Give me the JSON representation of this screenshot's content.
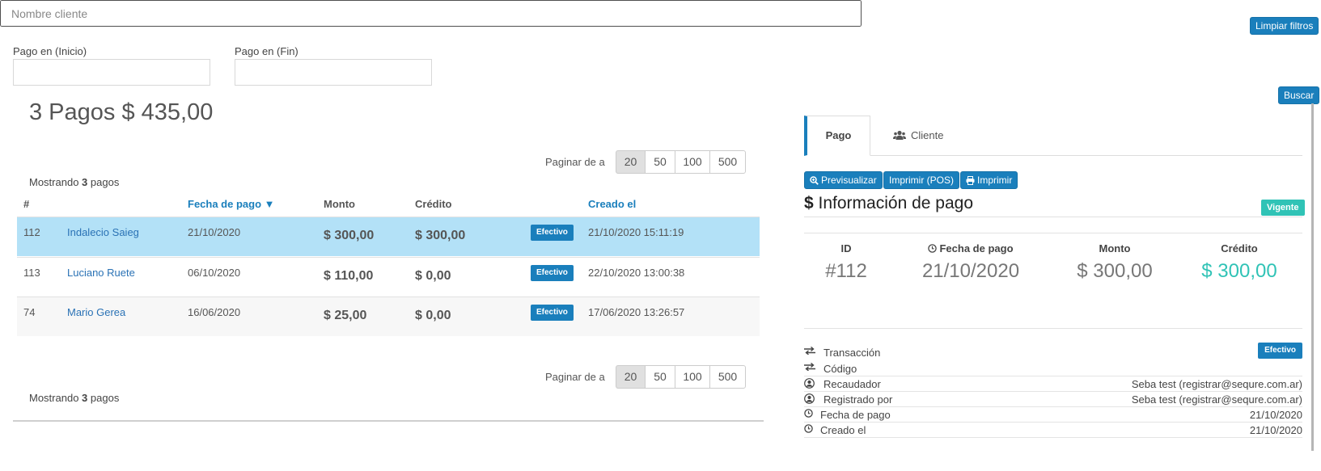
{
  "filters": {
    "search_placeholder": "Nombre cliente",
    "clear_label": "Limpiar filtros",
    "date_start_label": "Pago en (Inicio)",
    "date_end_label": "Pago en (Fin)",
    "search_button": "Buscar"
  },
  "summary": "3 Pagos $ 435,00",
  "pagination": {
    "label": "Paginar de a",
    "options": [
      "20",
      "50",
      "100",
      "500"
    ],
    "selected": "20"
  },
  "showing": {
    "prefix": "Mostrando ",
    "count": "3",
    "suffix": " pagos"
  },
  "table": {
    "headers": {
      "id": "#",
      "date": "Fecha de pago ▼",
      "amount": "Monto",
      "credit": "Crédito",
      "created": "Creado el"
    },
    "rows": [
      {
        "id": "112",
        "client": "Indalecio Saieg",
        "date": "21/10/2020",
        "amount": "$ 300,00",
        "credit": "$ 300,00",
        "method": "Efectivo",
        "created": "21/10/2020 15:11:19"
      },
      {
        "id": "113",
        "client": "Luciano Ruete",
        "date": "06/10/2020",
        "amount": "$ 110,00",
        "credit": "$ 0,00",
        "method": "Efectivo",
        "created": "22/10/2020 13:00:38"
      },
      {
        "id": "74",
        "client": "Mario Gerea",
        "date": "16/06/2020",
        "amount": "$ 25,00",
        "credit": "$ 0,00",
        "method": "Efectivo",
        "created": "17/06/2020 13:26:57"
      }
    ]
  },
  "detail": {
    "tabs": {
      "pago": "Pago",
      "cliente": "Cliente"
    },
    "actions": {
      "preview": "Previsualizar",
      "print_pos": "Imprimir (POS)",
      "print": "Imprimir"
    },
    "title": "Información de pago",
    "title_symbol": "$",
    "status": "Vigente",
    "stats": {
      "id_label": "ID",
      "id_value": "#112",
      "date_label": "Fecha de pago",
      "date_value": "21/10/2020",
      "amount_label": "Monto",
      "amount_value": "$ 300,00",
      "credit_label": "Crédito",
      "credit_value": "$ 300,00"
    },
    "fields": {
      "transaction_label": "Transacción",
      "transaction_value": "Efectivo",
      "code_label": "Código",
      "collector_label": "Recaudador",
      "collector_value": "Seba test (registrar@sequre.com.ar)",
      "registered_label": "Registrado por",
      "registered_value": "Seba test (registrar@sequre.com.ar)",
      "paydate_label": "Fecha de pago",
      "paydate_value": "21/10/2020",
      "created_label": "Creado el",
      "created_value": "21/10/2020"
    }
  },
  "colors": {
    "accent": "#1a7fbc",
    "teal": "#30c3b6",
    "selected_row": "#b3e1f7"
  }
}
